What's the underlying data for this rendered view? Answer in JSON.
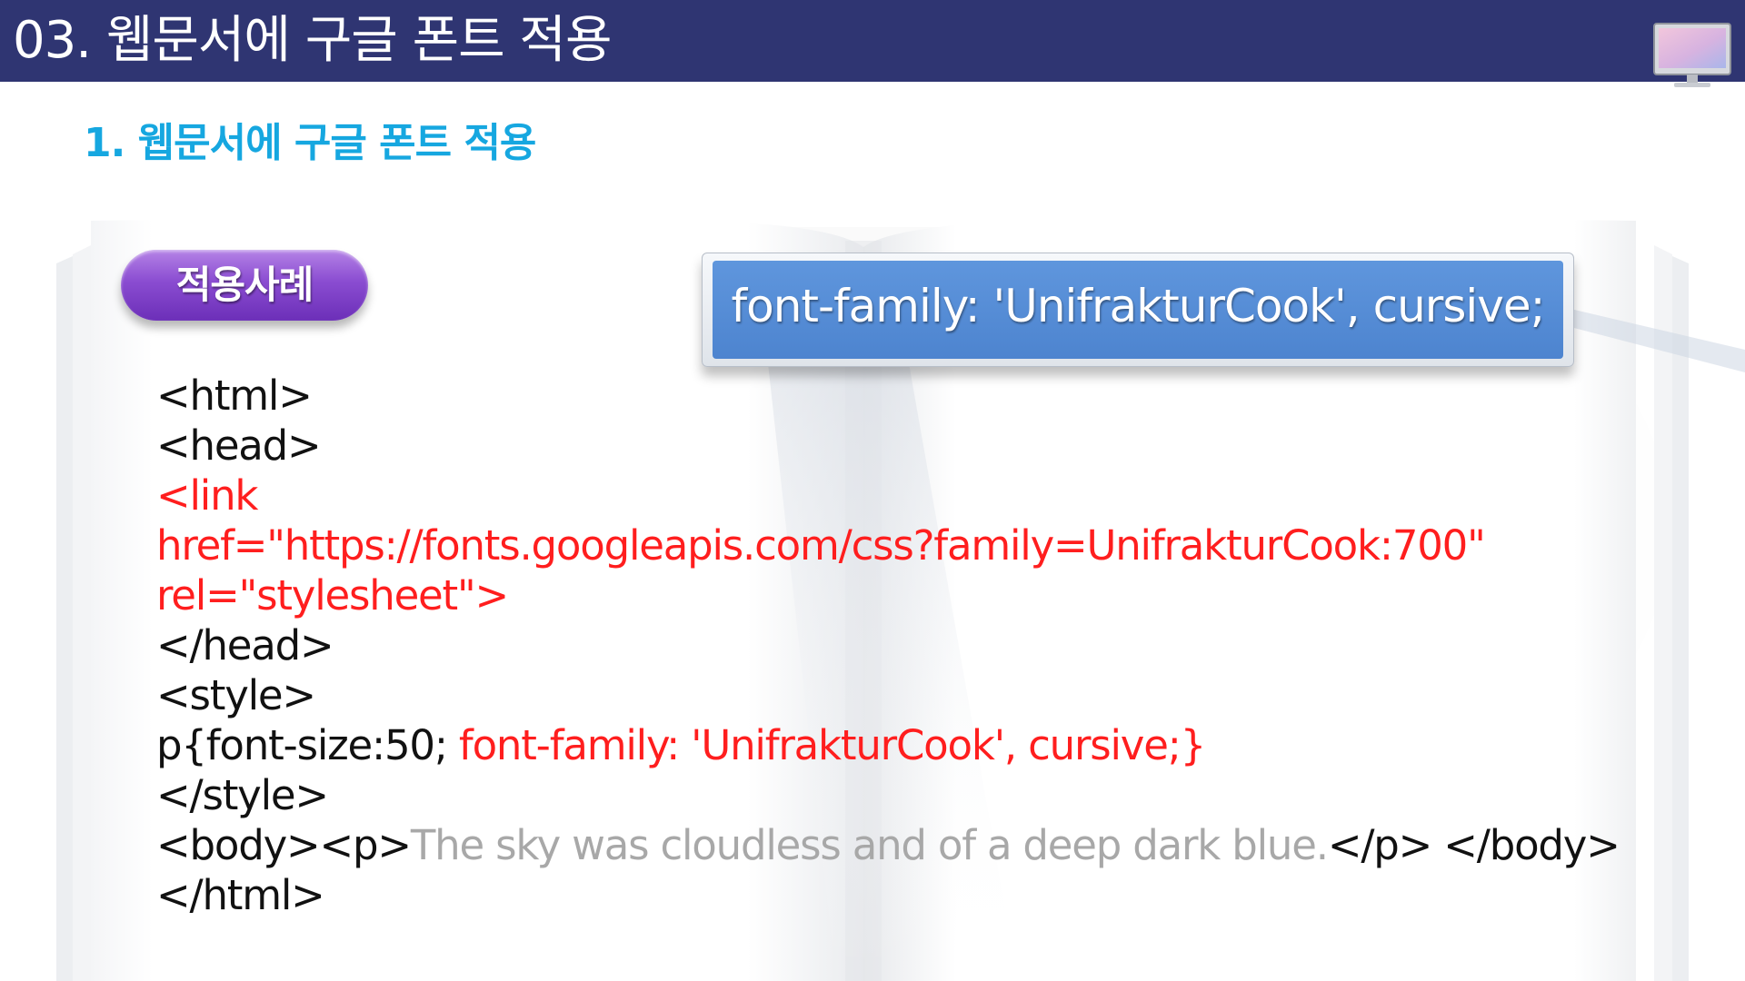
{
  "header": {
    "title": "03. 웹문서에 구글 폰트 적용",
    "icon": "monitor-icon",
    "bar_color": "#2f3572"
  },
  "subtitle": "1. 웹문서에 구글 폰트 적용",
  "badge": {
    "label": "적용사례"
  },
  "callout": {
    "text": "font-family: 'UnifrakturCook', cursive;"
  },
  "code": {
    "line1": "<html>",
    "line2": "<head>",
    "line3": "<link",
    "line4": "href=\"https://fonts.googleapis.com/css?family=UnifrakturCook:700\"",
    "line5": "rel=\"stylesheet\">",
    "line6": "</head>",
    "line7": "<style>",
    "line8_black": "p{font-size:50; ",
    "line8_red": "font-family: 'UnifrakturCook', cursive;}",
    "line9": "</style>",
    "line10_tags": "<body><p>",
    "line10_text": "The sky was cloudless and of a deep dark blue.",
    "line10_end": "</p> </body>",
    "line11": "</html>"
  },
  "colors": {
    "highlight_red": "#ff1e1e",
    "subtitle_blue": "#16a7e0",
    "badge_purple": "#8a4cd1",
    "callout_blue": "#5590d8",
    "muted_gray": "#a8a8a8"
  }
}
